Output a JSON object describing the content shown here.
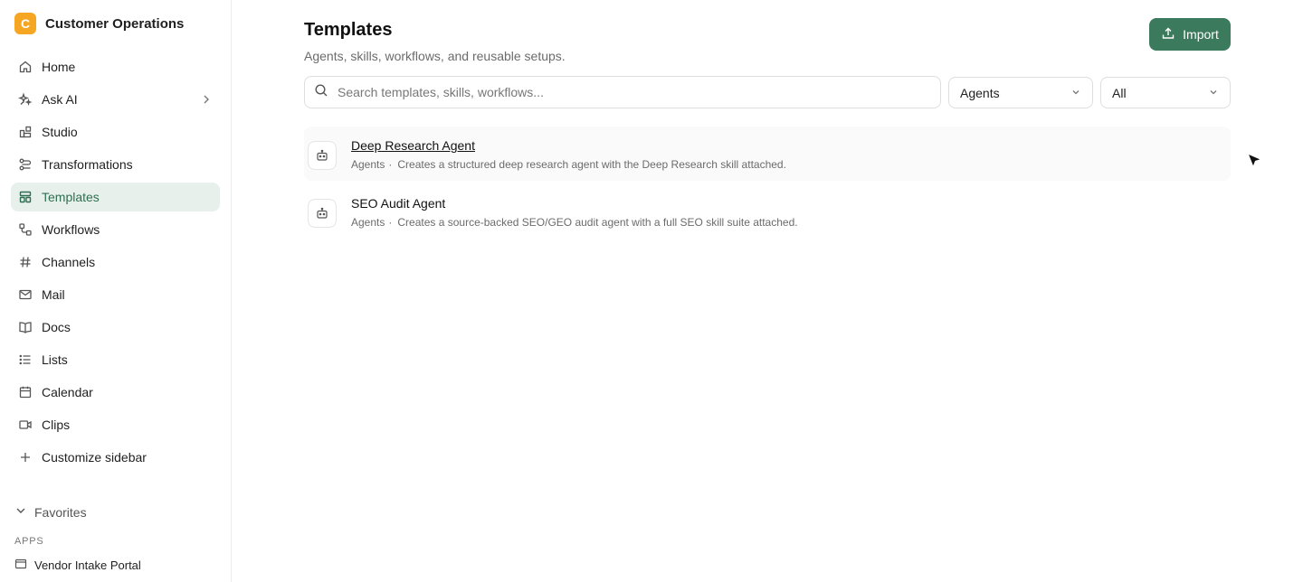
{
  "workspace": {
    "initial": "C",
    "name": "Customer Operations"
  },
  "sidebar": {
    "items": [
      {
        "label": "Home",
        "icon": "home-icon"
      },
      {
        "label": "Ask AI",
        "icon": "sparkle-icon"
      },
      {
        "label": "Studio",
        "icon": "blocks-icon"
      },
      {
        "label": "Transformations",
        "icon": "transform-icon"
      },
      {
        "label": "Templates",
        "icon": "templates-icon",
        "active": true
      },
      {
        "label": "Workflows",
        "icon": "workflow-icon"
      },
      {
        "label": "Channels",
        "icon": "hash-icon"
      },
      {
        "label": "Mail",
        "icon": "mail-icon"
      },
      {
        "label": "Docs",
        "icon": "book-icon"
      },
      {
        "label": "Lists",
        "icon": "list-icon"
      },
      {
        "label": "Calendar",
        "icon": "calendar-icon"
      },
      {
        "label": "Clips",
        "icon": "video-icon"
      },
      {
        "label": "Customize sidebar",
        "icon": "plus-icon"
      }
    ],
    "favorites_label": "Favorites",
    "apps_label": "APPS",
    "apps": [
      {
        "label": "Vendor Intake Portal",
        "icon": "app-window-icon"
      }
    ]
  },
  "page": {
    "title": "Templates",
    "subtitle": "Agents, skills, workflows, and reusable setups.",
    "import_label": "Import"
  },
  "filters": {
    "search_placeholder": "Search templates, skills, workflows...",
    "search_value": "",
    "type_selected": "Agents",
    "status_selected": "All"
  },
  "templates": [
    {
      "name": "Deep Research Agent",
      "category": "Agents",
      "description": "Creates a structured deep research agent with the Deep Research skill attached.",
      "icon": "bot-icon"
    },
    {
      "name": "SEO Audit Agent",
      "category": "Agents",
      "description": "Creates a source-backed SEO/GEO audit agent with a full SEO skill suite attached.",
      "icon": "bot-icon"
    }
  ],
  "colors": {
    "accent": "#3b7a5c",
    "active_bg": "#e8f0ec",
    "workspace_badge": "#f5a623"
  }
}
